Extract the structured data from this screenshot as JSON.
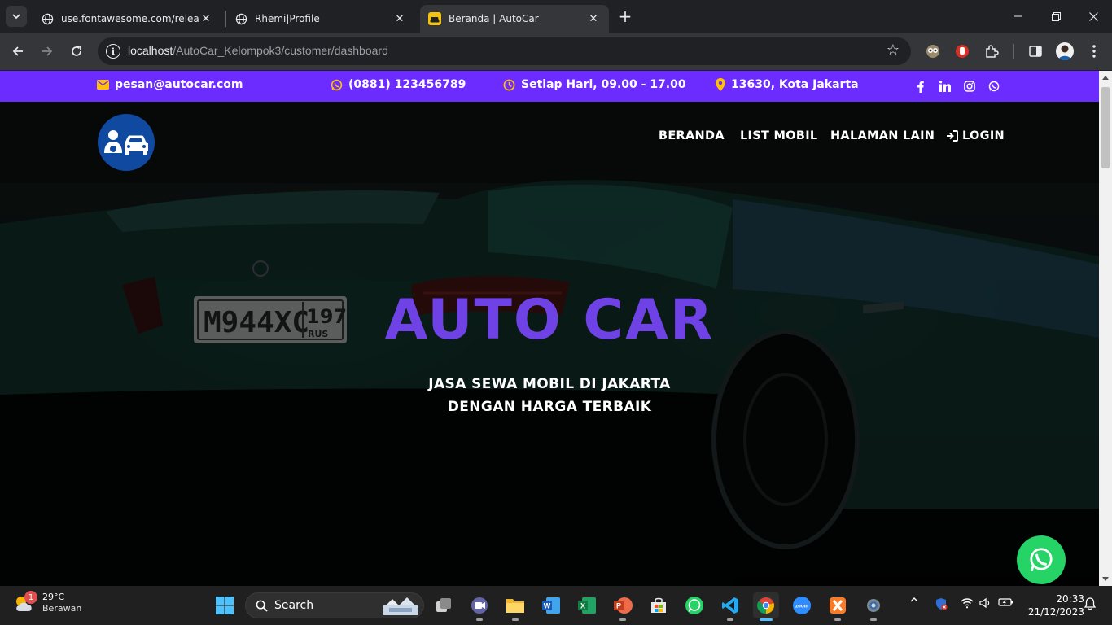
{
  "browser": {
    "tabs": [
      {
        "title": "use.fontawesome.com/releases/",
        "favicon": "globe-icon"
      },
      {
        "title": "Rhemi|Profile",
        "favicon": "globe-icon"
      },
      {
        "title": "Beranda | AutoCar",
        "favicon": "car-icon",
        "active": true
      }
    ],
    "url_host": "localhost",
    "url_path": "/AutoCar_Kelompok3/customer/dashboard"
  },
  "page": {
    "topbar": {
      "email": "pesan@autocar.com",
      "phone": "(0881) 123456789",
      "hours": "Setiap Hari, 09.00 - 17.00",
      "location": "13630, Kota Jakarta",
      "accent_icon_color": "#ffc107",
      "background": "#6d2cff"
    },
    "nav": {
      "items": [
        "BERANDA",
        "LIST MOBIL",
        "HALAMAN LAIN"
      ],
      "login": "LOGIN"
    },
    "hero": {
      "title": "AUTO CAR",
      "subtitle_line1": "JASA SEWA MOBIL DI JAKARTA",
      "subtitle_line2": "DENGAN HARGA TERBAIK",
      "title_color": "#6f42e6",
      "plate_text": "M944XC",
      "plate_region": "197",
      "plate_country": "RUS"
    }
  },
  "taskbar": {
    "weather_temp": "29°C",
    "weather_cond": "Berawan",
    "weather_badge": "1",
    "search_label": "Search",
    "time": "20:33",
    "date": "21/12/2023"
  }
}
